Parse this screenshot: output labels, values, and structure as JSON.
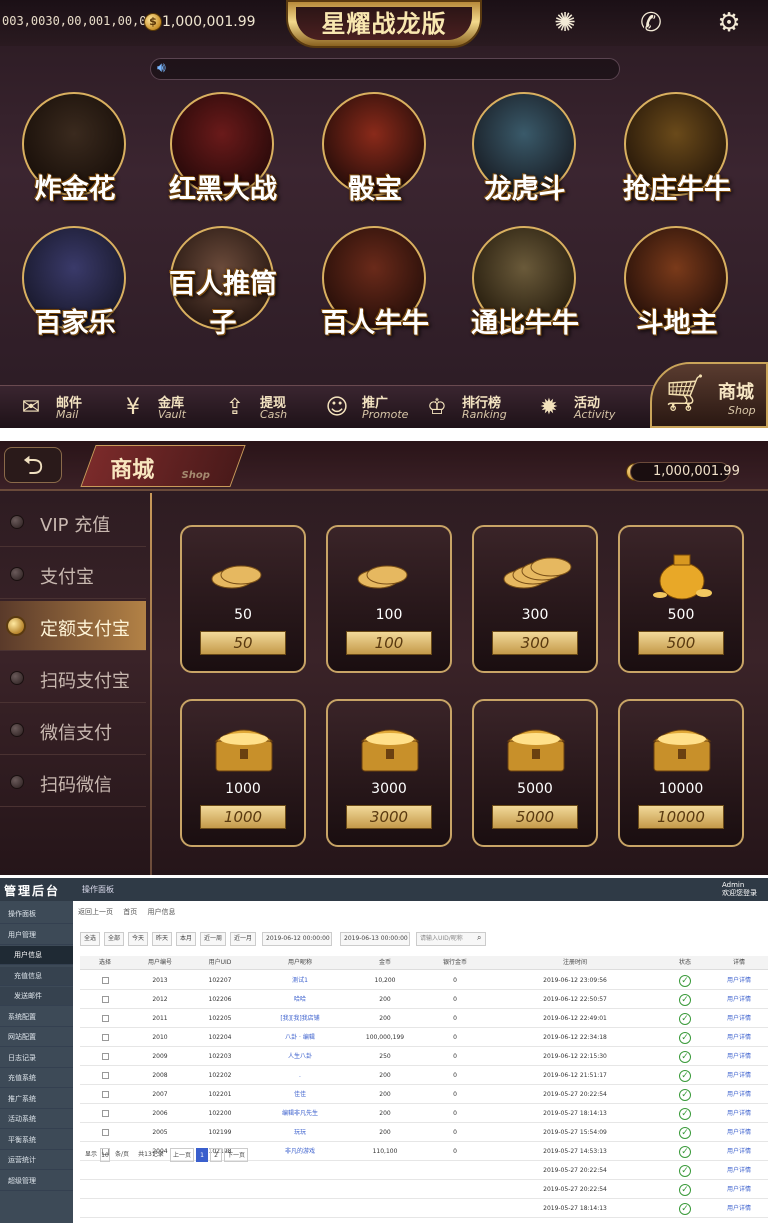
{
  "lobby": {
    "id_string": "003,0030,00,001,00,00",
    "balance": "1,000,001.99",
    "logo": "星耀战龙版",
    "coin_symbol": "$",
    "games": [
      {
        "name": "炸金花",
        "c1": "#3a2a1e",
        "c2": "#1a100a"
      },
      {
        "name": "红黑大战",
        "c1": "#6a1a1a",
        "c2": "#2a0a0a"
      },
      {
        "name": "骰宝",
        "c1": "#8a2a1a",
        "c2": "#2a0e0a"
      },
      {
        "name": "龙虎斗",
        "c1": "#3a5a6a",
        "c2": "#1a2028"
      },
      {
        "name": "抢庄牛牛",
        "c1": "#6a4a1a",
        "c2": "#2a1a0a"
      },
      {
        "name": "百家乐",
        "c1": "#3a3a6a",
        "c2": "#1a1a2e"
      },
      {
        "name": "百人推筒子",
        "c1": "#6a4a3a",
        "c2": "#2a1a14"
      },
      {
        "name": "百人牛牛",
        "c1": "#6a2a1a",
        "c2": "#2a100a"
      },
      {
        "name": "通比牛牛",
        "c1": "#6a5a3a",
        "c2": "#2a2010"
      },
      {
        "name": "斗地主",
        "c1": "#7a3a1a",
        "c2": "#2a120a"
      }
    ],
    "bottom_items": [
      {
        "label": "邮件",
        "en": "Mail",
        "icon": "✉"
      },
      {
        "label": "金库",
        "en": "Vault",
        "icon": "¥"
      },
      {
        "label": "提现",
        "en": "Cash",
        "icon": "⇪"
      },
      {
        "label": "推广",
        "en": "Promote",
        "icon": "☺"
      },
      {
        "label": "排行榜",
        "en": "Ranking",
        "icon": "♔"
      },
      {
        "label": "活动",
        "en": "Activity",
        "icon": "✹"
      }
    ],
    "shop_label": "商城",
    "shop_en": "Shop"
  },
  "shop": {
    "title": "商城",
    "title_en": "Shop",
    "balance": "1,000,001.99",
    "methods": [
      "VIP 充值",
      "支付宝",
      "定额支付宝",
      "扫码支付宝",
      "微信支付",
      "扫码微信"
    ],
    "active_index": 2,
    "items": [
      {
        "amount": "50",
        "price": "50",
        "kind": "coins-small"
      },
      {
        "amount": "100",
        "price": "100",
        "kind": "coins-small"
      },
      {
        "amount": "300",
        "price": "300",
        "kind": "coins-pile"
      },
      {
        "amount": "500",
        "price": "500",
        "kind": "bag"
      },
      {
        "amount": "1000",
        "price": "1000",
        "kind": "chest"
      },
      {
        "amount": "3000",
        "price": "3000",
        "kind": "chest"
      },
      {
        "amount": "5000",
        "price": "5000",
        "kind": "chest"
      },
      {
        "amount": "10000",
        "price": "10000",
        "kind": "chest"
      }
    ]
  },
  "admin": {
    "title": "管理后台",
    "tab": "操作面板",
    "user": "Admin",
    "user_sub": "欢迎您登录",
    "sidebar": [
      {
        "label": "操作面板",
        "sub": false,
        "cur": false
      },
      {
        "label": "用户管理",
        "sub": false,
        "cur": false
      },
      {
        "label": "用户信息",
        "sub": true,
        "cur": true
      },
      {
        "label": "充值信息",
        "sub": true,
        "cur": false
      },
      {
        "label": "发送邮件",
        "sub": true,
        "cur": false
      },
      {
        "label": "系统配置",
        "sub": false,
        "cur": false
      },
      {
        "label": "网站配置",
        "sub": false,
        "cur": false
      },
      {
        "label": "日志记录",
        "sub": false,
        "cur": false
      },
      {
        "label": "充值系统",
        "sub": false,
        "cur": false
      },
      {
        "label": "推广系统",
        "sub": false,
        "cur": false
      },
      {
        "label": "活动系统",
        "sub": false,
        "cur": false
      },
      {
        "label": "平衡系统",
        "sub": false,
        "cur": false
      },
      {
        "label": "运营统计",
        "sub": false,
        "cur": false
      },
      {
        "label": "超级管理",
        "sub": false,
        "cur": false
      }
    ],
    "breadcrumb": [
      "返回上一页",
      "首页",
      "用户信息"
    ],
    "toolbar": [
      "全选",
      "全部",
      "今天",
      "昨天",
      "本月",
      "近一周",
      "近一月"
    ],
    "date_from": "2019-06-12 00:00:00",
    "date_to": "2019-06-13 00:00:00",
    "search_placeholder": "请输入UID/昵称",
    "columns": [
      "选择",
      "用户编号",
      "用户UID",
      "用户昵称",
      "金币",
      "银行金币",
      "注册时间",
      "状态",
      "详情"
    ],
    "rows": [
      [
        "2013",
        "102207",
        "测试1",
        "10,200",
        "0",
        "2019-06-12 23:09:56"
      ],
      [
        "2012",
        "102206",
        "哈哈",
        "200",
        "0",
        "2019-06-12 22:50:57"
      ],
      [
        "2011",
        "102205",
        "[我][我]我店铺",
        "200",
        "0",
        "2019-06-12 22:49:01"
      ],
      [
        "2010",
        "102204",
        "八卦 · 编辑",
        "100,000,199",
        "0",
        "2019-06-12 22:34:18"
      ],
      [
        "2009",
        "102203",
        "人生八卦",
        "250",
        "0",
        "2019-06-12 22:15:30"
      ],
      [
        "2008",
        "102202",
        ".",
        "200",
        "0",
        "2019-06-12 21:51:17"
      ],
      [
        "2007",
        "102201",
        "佳佳",
        "200",
        "0",
        "2019-05-27 20:22:54"
      ],
      [
        "2006",
        "102200",
        "编辑非凡先生",
        "200",
        "0",
        "2019-05-27 18:14:13"
      ],
      [
        "2005",
        "102199",
        "玩玩",
        "200",
        "0",
        "2019-05-27 15:54:09"
      ],
      [
        "2004",
        "102198",
        "非凡的游戏",
        "110,100",
        "0",
        "2019-05-27 14:53:13"
      ]
    ],
    "extra_dates": [
      "2019-05-27 20:22:54",
      "2019-05-27 20:22:54",
      "2019-05-27 18:14:13"
    ],
    "detail_link": "用户详情",
    "pager": {
      "show": "显示",
      "per": "10",
      "per_unit": "条/页",
      "total": "共13记录",
      "prev": "上一页",
      "p1": "1",
      "p2": "2",
      "next": "下一页"
    }
  }
}
